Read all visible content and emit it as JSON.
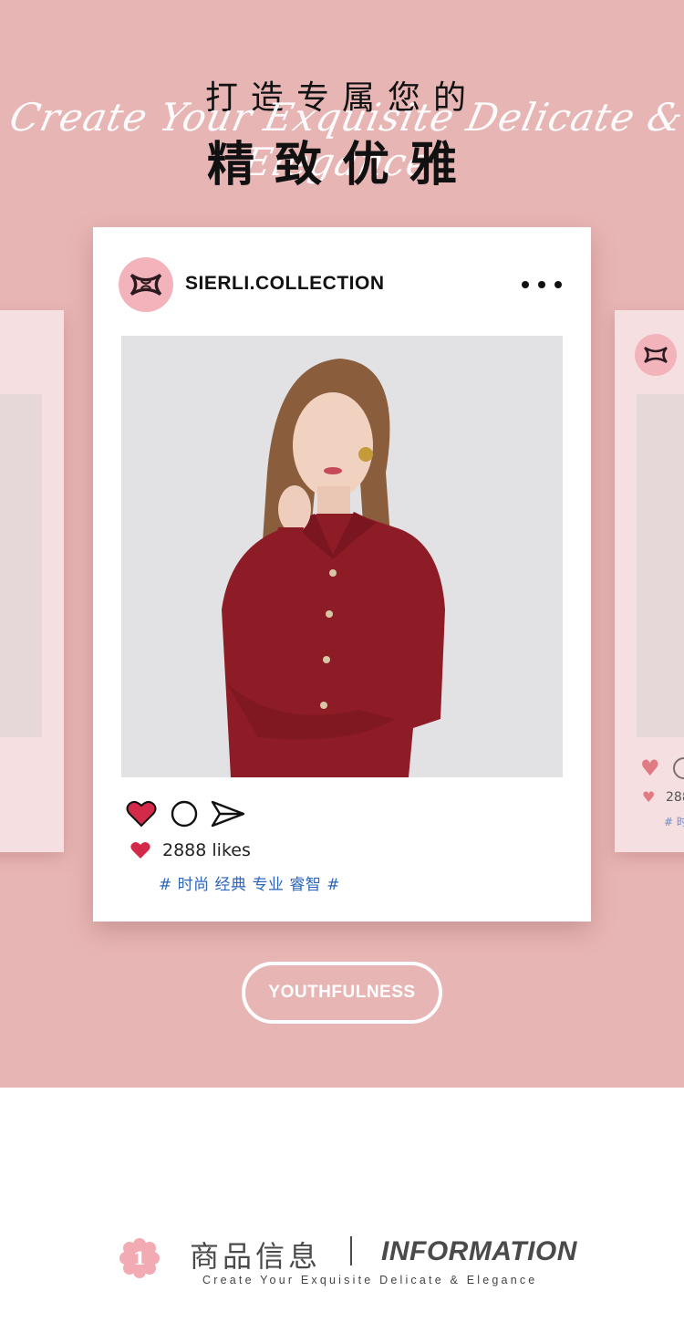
{
  "hero": {
    "headline_line1": "打造专属您的",
    "script_tagline": "Create Your Exquisite Delicate & Elegance",
    "headline_line2": "精致优雅",
    "background_color": "#e8b5b5"
  },
  "post": {
    "account_name": "SIERLI.COLLECTION",
    "avatar_icon": "sierli-monogram-icon",
    "more_icon": "more-dots-icon",
    "actions": {
      "like_icon": "heart-icon",
      "comment_icon": "comment-circle-icon",
      "share_icon": "paper-plane-icon"
    },
    "likes_label": "2888 likes",
    "hashtags": "# 时尚 经典 专业 睿智 #",
    "like_color": "#d42a4a",
    "hashtag_color": "#2c66b8"
  },
  "side_cards": {
    "right": {
      "likes_partial": "288",
      "tag_partial": "# 时"
    }
  },
  "cta": {
    "label": "YOUTHFULNESS"
  },
  "info": {
    "badge_number": "1",
    "title_cn": "商品信息",
    "title_en": "INFORMATION",
    "subtitle": "Create Your Exquisite Delicate & Elegance",
    "badge_color": "#f2aab3"
  }
}
